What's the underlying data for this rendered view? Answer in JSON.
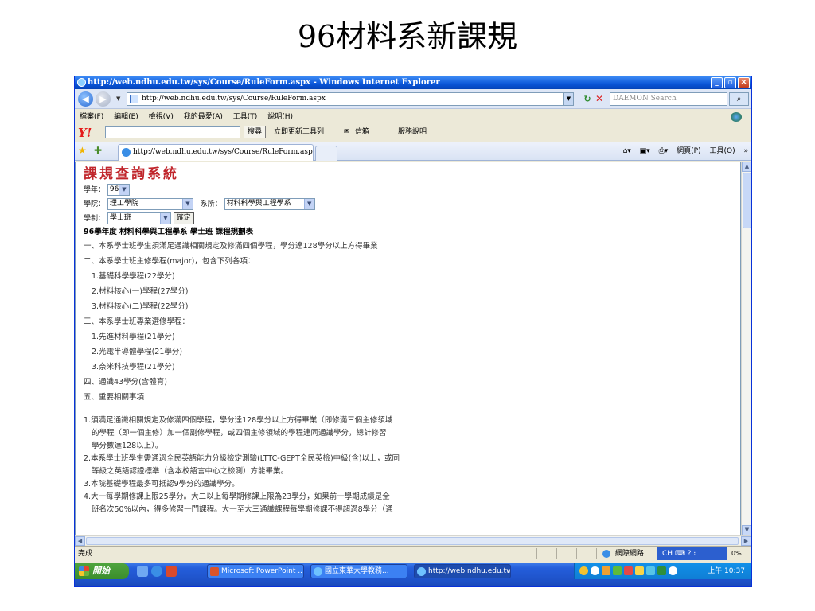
{
  "slide_title": "96材料系新課規",
  "window": {
    "title": "http://web.ndhu.edu.tw/sys/Course/RuleForm.aspx - Windows Internet Explorer",
    "controls": {
      "minimize": "_",
      "maximize": "▫",
      "close": "✕"
    }
  },
  "address": {
    "url": "http://web.ndhu.edu.tw/sys/Course/RuleForm.aspx",
    "search_placeholder": "DAEMON Search",
    "back": "◀",
    "forward": "▶"
  },
  "menu": [
    "檔案(F)",
    "編輯(E)",
    "檢視(V)",
    "我的最愛(A)",
    "工具(T)",
    "說明(H)"
  ],
  "yahoo": {
    "logo": "Y!",
    "search_button": "搜尋",
    "update": "立即更新工具列",
    "mail": "信箱",
    "help": "服務說明"
  },
  "tab": {
    "title": "http://web.ndhu.edu.tw/sys/Course/RuleForm.aspx"
  },
  "commands": [
    "網頁(P)",
    "工具(O)"
  ],
  "page": {
    "heading": "課規查詢系統",
    "year_label": "學年：",
    "year_value": "96",
    "college_label": "學院：",
    "college_value": "理工學院",
    "dept_label": "系所：",
    "dept_value": "材料科學與工程學系",
    "system_label": "學制：",
    "system_value": "學士班",
    "confirm": "確定",
    "table_title": "96學年度 材料科學與工程學系 學士班 課程規劃表",
    "lines": [
      {
        "text": "一、本系學士班學生須滿足通識相關規定及修滿四個學程，學分達128學分以上方得畢業",
        "indent": false
      },
      {
        "text": "二、本系學士班主修學程(major)，包含下列各項：",
        "indent": false
      },
      {
        "text": "1.基礎科學學程(22學分)",
        "indent": true
      },
      {
        "text": "2.材料核心(一)學程(27學分)",
        "indent": true
      },
      {
        "text": "3.材料核心(二)學程(22學分)",
        "indent": true
      },
      {
        "text": "三、本系學士班專業選修學程：",
        "indent": false
      },
      {
        "text": "1.先進材料學程(21學分)",
        "indent": true
      },
      {
        "text": "2.光電半導體學程(21學分)",
        "indent": true
      },
      {
        "text": "3.奈米科技學程(21學分)",
        "indent": true
      },
      {
        "text": "四、通識43學分(含體育)",
        "indent": false
      },
      {
        "text": "五、重要相關事項",
        "indent": false
      }
    ],
    "notes": [
      {
        "text": "1.須滿足通識相關規定及修滿四個學程，學分達128學分以上方得畢業（即修滿三個主修領域",
        "cont": false
      },
      {
        "text": "的學程（即一個主修）加一個副修學程，或四個主修領域的學程連同通識學分，總計修習",
        "cont": true
      },
      {
        "text": "學分數達128以上）。",
        "cont": true
      },
      {
        "text": "2.本系學士班學生需通過全民英語能力分級檢定測驗(LTTC-GEPT全民英檢)中級(含)以上，或同",
        "cont": false
      },
      {
        "text": "等級之英語認證標準（含本校語言中心之檢測）方能畢業。",
        "cont": true
      },
      {
        "text": "3.本院基礎學程最多可抵認9學分的通識學分。",
        "cont": false
      },
      {
        "text": "4.大一每學期修課上限25學分。大二以上每學期修課上限為23學分，如果前一學期成績是全",
        "cont": false
      },
      {
        "text": "班名次50%以內，得多修習一門課程。大一至大三通識課程每學期修課不得超過8學分（通",
        "cont": true
      }
    ]
  },
  "status": {
    "text": "完成",
    "zone": "網際網路",
    "lang": "CH",
    "zoom": "0%"
  },
  "taskbar": {
    "start": "開始",
    "tasks": [
      "Microsoft PowerPoint ...",
      "國立東華大學教務...",
      "http://web.ndhu.edu.tw..."
    ],
    "clock": "上午 10:37"
  }
}
